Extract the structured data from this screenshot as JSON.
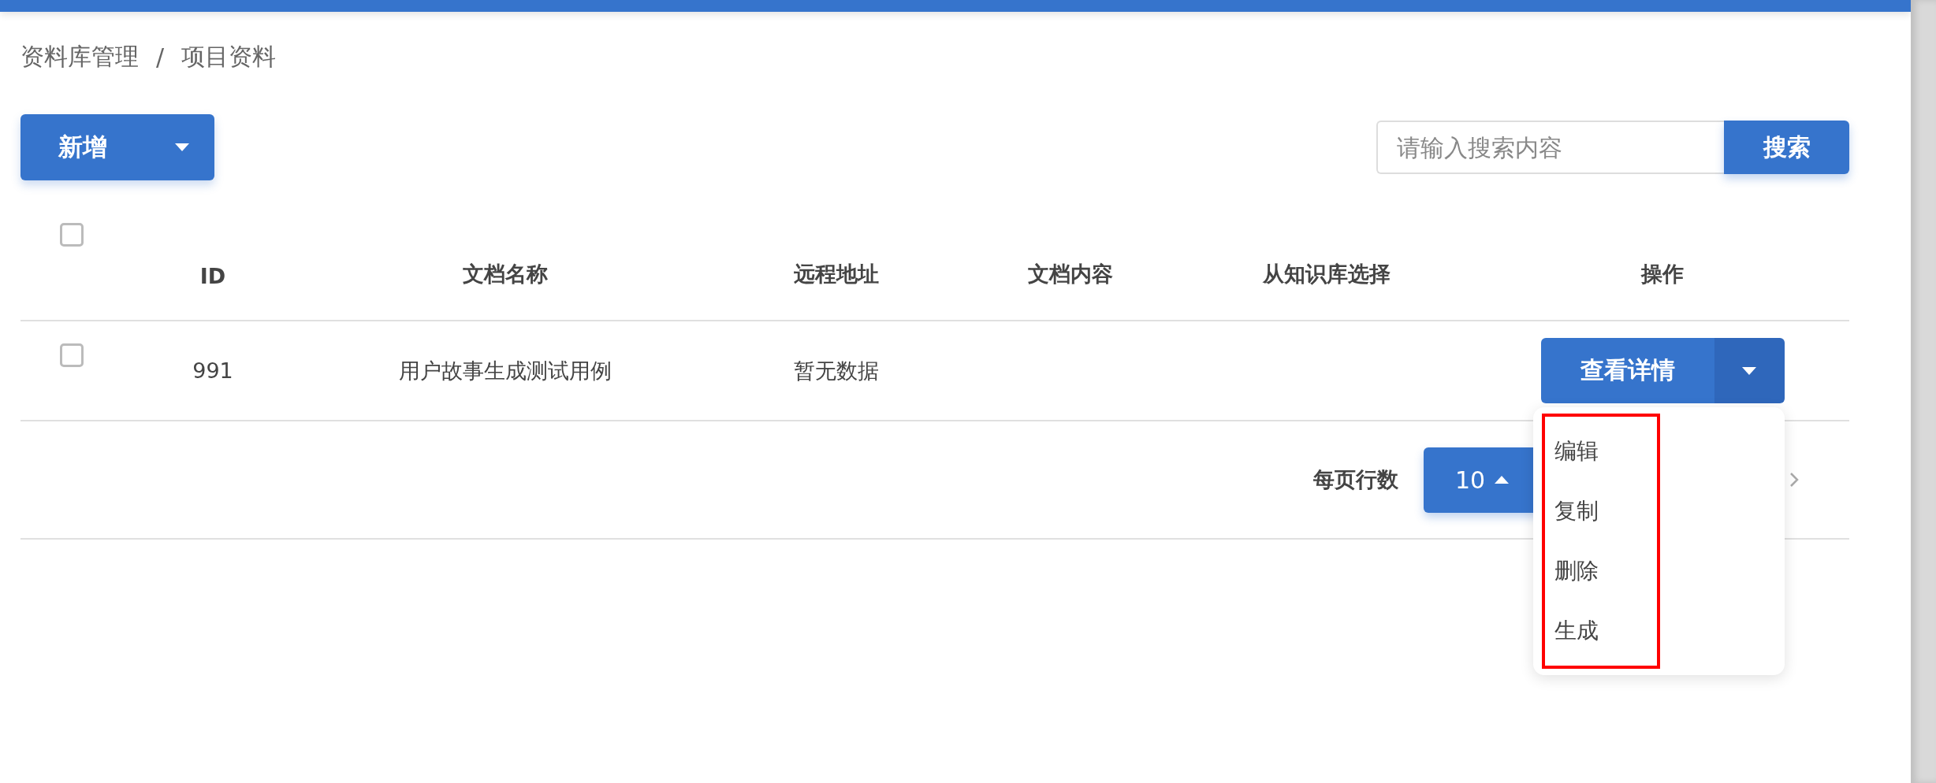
{
  "breadcrumb": {
    "items": [
      "资料库管理",
      "项目资料"
    ],
    "separator": "/"
  },
  "toolbar": {
    "add_button": "新增",
    "search": {
      "placeholder": "请输入搜索内容",
      "button": "搜索"
    }
  },
  "table": {
    "header_checkbox": {
      "checked": false
    },
    "columns": [
      "ID",
      "文档名称",
      "远程地址",
      "文档内容",
      "从知识库选择",
      "操作"
    ],
    "rows": [
      {
        "checked": false,
        "id": "991",
        "name": "用户故事生成测试用例",
        "remote": "暂无数据",
        "action": "查看详情"
      }
    ]
  },
  "action_menu": {
    "expanded": true,
    "items": [
      "编辑",
      "复制",
      "删除",
      "生成"
    ]
  },
  "pagination": {
    "label": "每页行数",
    "page_size": "10"
  }
}
